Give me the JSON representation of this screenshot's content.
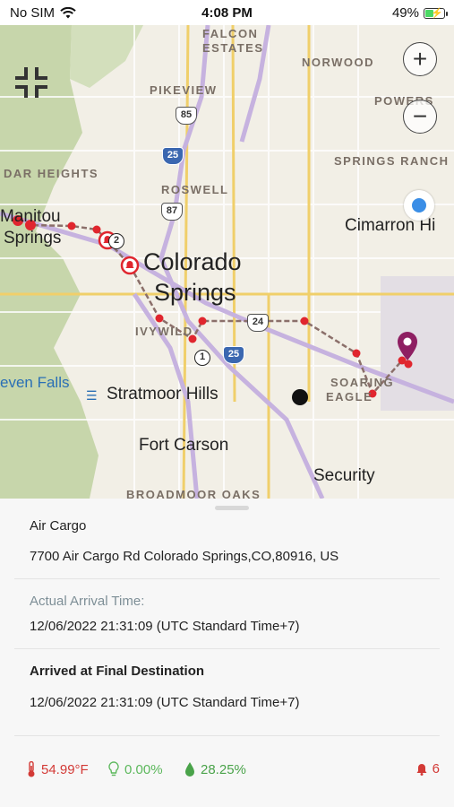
{
  "status_bar": {
    "carrier": "No SIM",
    "time": "4:08 PM",
    "battery": "49%",
    "battery_level": 0.49
  },
  "map": {
    "labels": {
      "falcon_estates_1": "FALCON",
      "falcon_estates_2": "ESTATES",
      "norwood": "NORWOOD",
      "pikeview": "PIKEVIEW",
      "powers": "POWERS",
      "springs_ranch": "SPRINGS RANCH",
      "dar_heights": "DAR HEIGHTS",
      "roswell": "ROSWELL",
      "manitou_1": "Manitou",
      "manitou_2": "Springs",
      "cimarron": "Cimarron Hi",
      "colorado_1": "Colorado",
      "colorado_2": "Springs",
      "ivywild": "IVYWILD",
      "seven_falls": "even Falls",
      "stratmoor": "Stratmoor Hills",
      "soaring_1": "SOARING",
      "soaring_2": "EAGLE",
      "fort_carson": "Fort Carson",
      "security": "Security",
      "broadmoor": "BROADMOOR OAKS"
    },
    "shields": {
      "us85": "85",
      "i25_north": "25",
      "us87": "87",
      "us24": "24",
      "i25_south": "25"
    },
    "markers": {
      "stop_1": "1",
      "stop_2": "2"
    },
    "colors": {
      "route": "#8b6f6a",
      "point": "#e0262e",
      "destination": "#8e1f62",
      "land": "#f2efe6",
      "terrain": "#c9d8b0",
      "highway": "#c9b7e0"
    }
  },
  "details": {
    "location_name": "Air Cargo",
    "address": "7700 Air Cargo Rd Colorado Springs,CO,80916, US",
    "actual_arrival_label": "Actual Arrival Time:",
    "actual_arrival_time": "12/06/2022 21:31:09 (UTC Standard Time+7)",
    "final_label": "Arrived at Final Destination",
    "final_time": "12/06/2022 21:31:09 (UTC Standard Time+7)"
  },
  "sensors": {
    "temperature": "54.99°F",
    "humidity": "0.00%",
    "moisture": "28.25%",
    "alerts": "6",
    "temp_color": "#d33a36",
    "humidity_color": "#5cb85c"
  }
}
